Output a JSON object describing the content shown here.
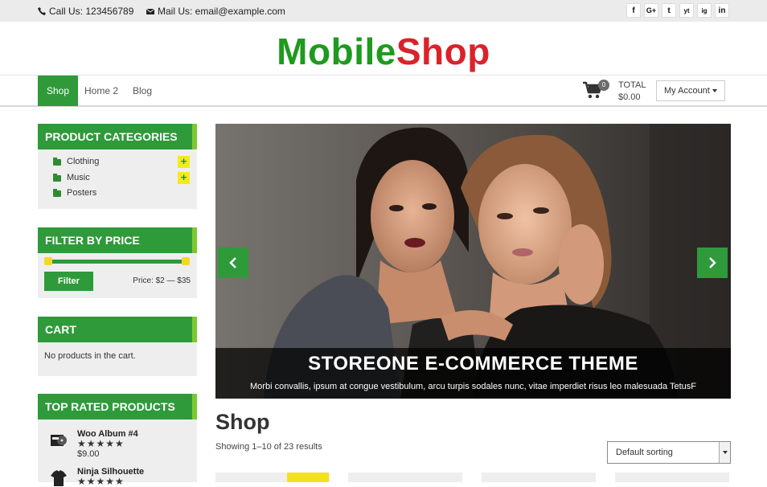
{
  "topbar": {
    "call": "Call Us: 123456789",
    "mail": "Mail Us: email@example.com",
    "social": [
      "f",
      "G+",
      "t",
      "yt",
      "ig",
      "in"
    ]
  },
  "logo": {
    "part1": "Mobile",
    "part2": "Shop",
    "color1": "#1e9a1e",
    "color2": "#d9232a"
  },
  "nav": {
    "items": [
      {
        "label": "Shop",
        "active": true
      },
      {
        "label": "Home 2",
        "active": false
      },
      {
        "label": "Blog",
        "active": false
      }
    ],
    "cart_count": "0",
    "total_label": "TOTAL",
    "total_value": "$0.00",
    "account_label": "My Account"
  },
  "sidebar": {
    "categories": {
      "title": "PRODUCT CATEGORIES",
      "items": [
        {
          "label": "Clothing",
          "expandable": true
        },
        {
          "label": "Music",
          "expandable": true
        },
        {
          "label": "Posters",
          "expandable": false
        }
      ]
    },
    "price_filter": {
      "title": "FILTER BY PRICE",
      "button": "Filter",
      "range_text": "Price: $2 — $35"
    },
    "cart": {
      "title": "CART",
      "empty_text": "No products in the cart."
    },
    "top_rated": {
      "title": "TOP RATED PRODUCTS",
      "items": [
        {
          "name": "Woo Album #4",
          "stars": "★★★★★",
          "price": "$9.00",
          "icon": "album-icon"
        },
        {
          "name": "Ninja Silhouette",
          "stars": "★★★★★",
          "price": "",
          "icon": "tshirt-icon"
        }
      ]
    }
  },
  "hero": {
    "title": "STOREONE E-COMMERCE THEME",
    "subtitle": "Morbi convallis, ipsum at congue vestibulum, arcu turpis sodales nunc, vitae imperdiet risus leo malesuada TetusF"
  },
  "shop": {
    "title": "Shop",
    "result_count": "Showing 1–10 of 23 results",
    "sort_label": "Default sorting"
  },
  "colors": {
    "accent": "#2e9a3a",
    "accent_light": "#7dc832",
    "highlight": "#f3ea1c"
  }
}
